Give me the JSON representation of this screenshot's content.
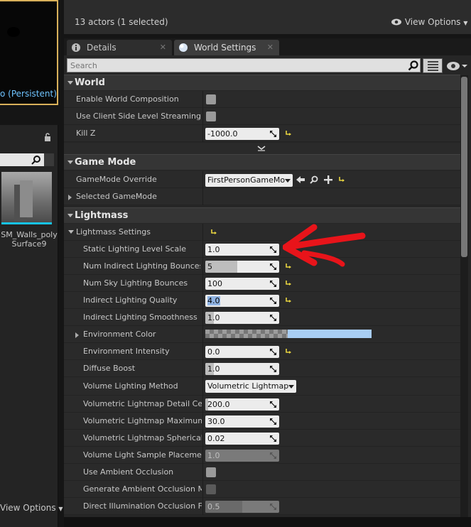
{
  "left": {
    "level_label": "o (Persistent)",
    "asset_label": "SM_Walls_poly Surface9",
    "view_options": "View Options"
  },
  "top": {
    "actors_count": "13 actors (1 selected)",
    "view_options": "View Options"
  },
  "tabs": [
    {
      "label": "Details",
      "icon": "details-icon",
      "active": false
    },
    {
      "label": "World Settings",
      "icon": "globe-icon",
      "active": true
    }
  ],
  "search": {
    "placeholder": "Search"
  },
  "sections": {
    "world": "World",
    "game_mode": "Game Mode",
    "lightmass": "Lightmass"
  },
  "world": {
    "enable_world_composition": "Enable World Composition",
    "client_side_streaming": "Use Client Side Level Streaming Vo",
    "kill_z_label": "Kill Z",
    "kill_z_value": "-1000.0"
  },
  "game_mode": {
    "override_label": "GameMode Override",
    "override_value": "FirstPersonGameMo",
    "selected_label": "Selected GameMode"
  },
  "lightmass": {
    "settings_label": "Lightmass Settings",
    "static_scale_label": "Static Lighting Level Scale",
    "static_scale_value": "1.0",
    "indirect_bounces_label": "Num Indirect Lighting Bounces",
    "indirect_bounces_value": "5",
    "sky_bounces_label": "Num Sky Lighting Bounces",
    "sky_bounces_value": "100",
    "indirect_quality_label": "Indirect Lighting Quality",
    "indirect_quality_value": "4.0",
    "indirect_smoothness_label": "Indirect Lighting Smoothness",
    "indirect_smoothness_value": "1.0",
    "env_color_label": "Environment Color",
    "env_intensity_label": "Environment Intensity",
    "env_intensity_value": "0.0",
    "diffuse_boost_label": "Diffuse Boost",
    "diffuse_boost_value": "1.0",
    "volume_method_label": "Volume Lighting Method",
    "volume_method_value": "Volumetric Lightmap",
    "vl_detail_label": "Volumetric Lightmap Detail Cell S",
    "vl_detail_value": "200.0",
    "vl_max_label": "Volumetric Lightmap Maximum B",
    "vl_max_value": "30.0",
    "vl_spherical_label": "Volumetric Lightmap Spherical Ha",
    "vl_spherical_value": "0.02",
    "sample_placement_label": "Volume Light Sample Placement",
    "sample_placement_value": "1.0",
    "ambient_occlusion_label": "Use Ambient Occlusion",
    "gen_ao_label": "Generate Ambient Occlusion Mate",
    "direct_occlusion_label": "Direct Illumination Occlusion Frac",
    "direct_occlusion_value": "0.5"
  },
  "colors": {
    "accent_selection": "#8fb3e3",
    "environment_color": "#a8cdf3",
    "annotation_arrow": "#e8141a",
    "asset_bar": "#17c3e6"
  }
}
